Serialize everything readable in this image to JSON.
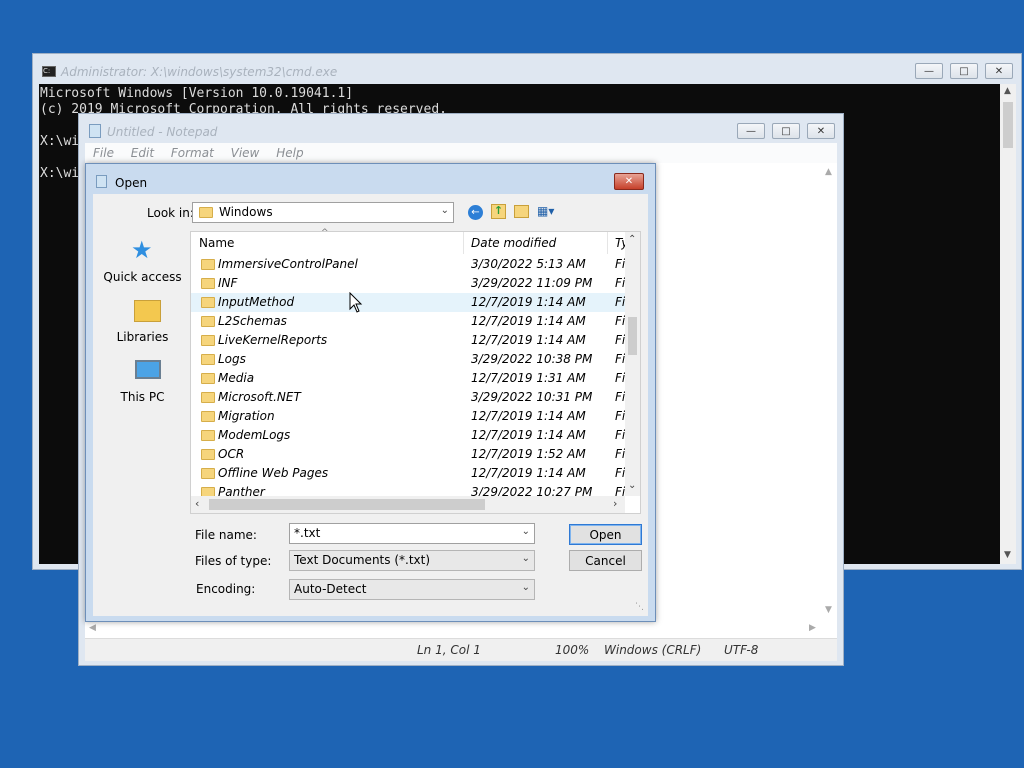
{
  "cmd": {
    "title": "Administrator: X:\\windows\\system32\\cmd.exe",
    "lines": [
      "Microsoft Windows [Version 10.0.19041.1]",
      "(c) 2019 Microsoft Corporation. All rights reserved.",
      "",
      "X:\\wi",
      "",
      "X:\\wi"
    ]
  },
  "notepad": {
    "title": "Untitled - Notepad",
    "menu": [
      "File",
      "Edit",
      "Format",
      "View",
      "Help"
    ],
    "status": {
      "position": "Ln 1, Col 1",
      "zoom": "100%",
      "line_ending": "Windows (CRLF)",
      "encoding": "UTF-8"
    }
  },
  "dialog": {
    "title": "Open",
    "look_in_label": "Look in:",
    "look_in_value": "Windows",
    "places": [
      "Quick access",
      "Libraries",
      "This PC"
    ],
    "columns": {
      "name": "Name",
      "date": "Date modified",
      "type": "Ty"
    },
    "rows": [
      {
        "name": "ImmersiveControlPanel",
        "date": "3/30/2022 5:13 AM",
        "type": "Fi"
      },
      {
        "name": "INF",
        "date": "3/29/2022 11:09 PM",
        "type": "Fi"
      },
      {
        "name": "InputMethod",
        "date": "12/7/2019 1:14 AM",
        "type": "Fi"
      },
      {
        "name": "L2Schemas",
        "date": "12/7/2019 1:14 AM",
        "type": "Fi"
      },
      {
        "name": "LiveKernelReports",
        "date": "12/7/2019 1:14 AM",
        "type": "Fi"
      },
      {
        "name": "Logs",
        "date": "3/29/2022 10:38 PM",
        "type": "Fi"
      },
      {
        "name": "Media",
        "date": "12/7/2019 1:31 AM",
        "type": "Fi"
      },
      {
        "name": "Microsoft.NET",
        "date": "3/29/2022 10:31 PM",
        "type": "Fi"
      },
      {
        "name": "Migration",
        "date": "12/7/2019 1:14 AM",
        "type": "Fi"
      },
      {
        "name": "ModemLogs",
        "date": "12/7/2019 1:14 AM",
        "type": "Fi"
      },
      {
        "name": "OCR",
        "date": "12/7/2019 1:52 AM",
        "type": "Fi"
      },
      {
        "name": "Offline Web Pages",
        "date": "12/7/2019 1:14 AM",
        "type": "Fi"
      },
      {
        "name": "Panther",
        "date": "3/29/2022 10:27 PM",
        "type": "Fi"
      }
    ],
    "file_name_label": "File name:",
    "file_name_value": "*.txt",
    "file_type_label": "Files of type:",
    "file_type_value": "Text Documents (*.txt)",
    "encoding_label": "Encoding:",
    "encoding_value": "Auto-Detect",
    "open_label": "Open",
    "cancel_label": "Cancel"
  }
}
